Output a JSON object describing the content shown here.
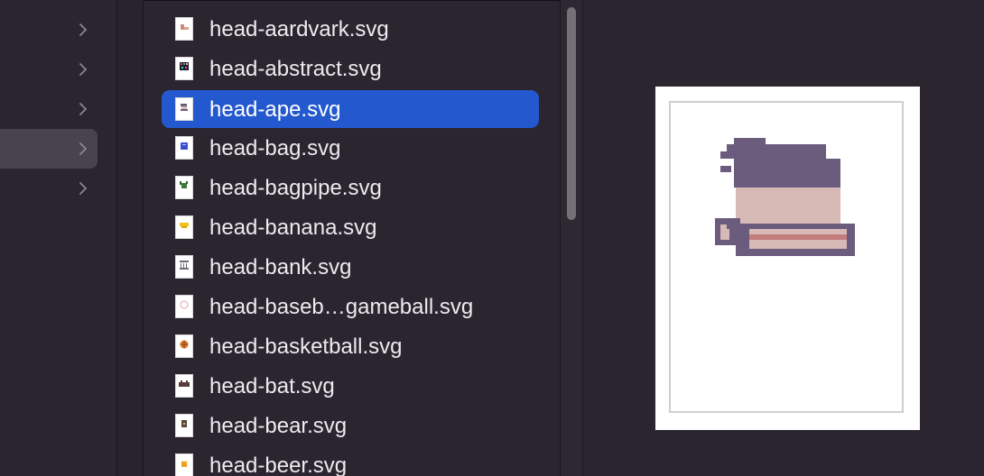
{
  "sidebar": {
    "rows": [
      {
        "icon": "chevron-right-icon",
        "selected": false
      },
      {
        "icon": "chevron-right-icon",
        "selected": false
      },
      {
        "icon": "chevron-right-icon",
        "selected": false
      },
      {
        "icon": "chevron-right-icon",
        "selected": true
      },
      {
        "icon": "chevron-right-icon",
        "selected": false
      }
    ]
  },
  "files": [
    {
      "name": "head-aardvark.svg",
      "icon": "aardvark-thumbnail-icon",
      "selected": false
    },
    {
      "name": "head-abstract.svg",
      "icon": "abstract-thumbnail-icon",
      "selected": false
    },
    {
      "name": "head-ape.svg",
      "icon": "ape-thumbnail-icon",
      "selected": true
    },
    {
      "name": "head-bag.svg",
      "icon": "bag-thumbnail-icon",
      "selected": false
    },
    {
      "name": "head-bagpipe.svg",
      "icon": "bagpipe-thumbnail-icon",
      "selected": false
    },
    {
      "name": "head-banana.svg",
      "icon": "banana-thumbnail-icon",
      "selected": false
    },
    {
      "name": "head-bank.svg",
      "icon": "bank-thumbnail-icon",
      "selected": false
    },
    {
      "name": "head-baseb…gameball.svg",
      "icon": "baseball-gameball-thumbnail-icon",
      "selected": false
    },
    {
      "name": "head-basketball.svg",
      "icon": "basketball-thumbnail-icon",
      "selected": false
    },
    {
      "name": "head-bat.svg",
      "icon": "bat-thumbnail-icon",
      "selected": false
    },
    {
      "name": "head-bear.svg",
      "icon": "bear-thumbnail-icon",
      "selected": false
    },
    {
      "name": "head-beer.svg",
      "icon": "beer-thumbnail-icon",
      "selected": false
    }
  ],
  "preview": {
    "file": "head-ape.svg",
    "image": "ape-head-pixel-art"
  },
  "colors": {
    "background": "#2b2530",
    "selection": "#2458cf",
    "sidebar_selected": "#48434d",
    "ape_purple": "#6b5b7c",
    "ape_skin": "#d7b9b6",
    "ape_mouth": "#c47c7c"
  }
}
